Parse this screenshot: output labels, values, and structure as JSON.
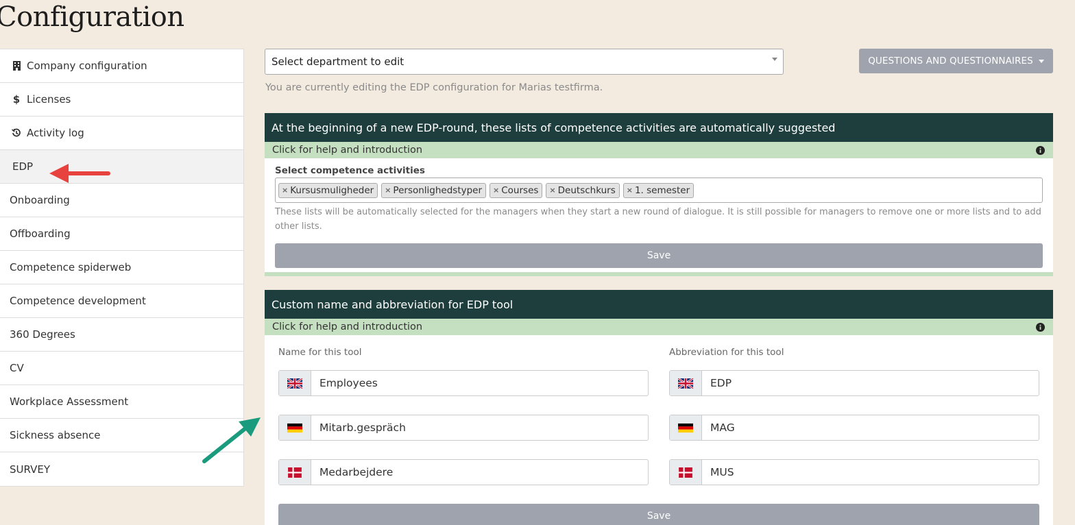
{
  "page": {
    "title": "Configuration"
  },
  "sidebar": {
    "items": [
      {
        "label": "Company configuration",
        "icon": "building-icon"
      },
      {
        "label": "Licenses",
        "icon": "dollar-icon"
      },
      {
        "label": "Activity log",
        "icon": "history-icon"
      },
      {
        "label": "EDP",
        "active": true
      },
      {
        "label": "Onboarding"
      },
      {
        "label": "Offboarding"
      },
      {
        "label": "Competence spiderweb"
      },
      {
        "label": "Competence development"
      },
      {
        "label": "360 Degrees"
      },
      {
        "label": "CV"
      },
      {
        "label": "Workplace Assessment"
      },
      {
        "label": "Sickness absence"
      },
      {
        "label": "SURVEY"
      }
    ]
  },
  "top": {
    "department_select": "Select department to edit",
    "questions_button": "QUESTIONS AND QUESTIONNAIRES",
    "edit_note": "You are currently editing the EDP configuration for Marias testfirma."
  },
  "panel1": {
    "header": "At the beginning of a new EDP-round, these lists of competence activities are automatically suggested",
    "help": "Click for help and introduction",
    "field_label": "Select competence activities",
    "tags": [
      "Kursusmuligheder",
      "Personlighedstyper",
      "Courses",
      "Deutschkurs",
      "1. semester"
    ],
    "tag_remove_symbol": "×",
    "help_text": "These lists will be automatically selected for the managers when they start a new round of dialogue. It is still possible for managers to remove one or more lists and to add other lists.",
    "save": "Save"
  },
  "panel2": {
    "header": "Custom name and abbreviation for EDP tool",
    "help": "Click for help and introduction",
    "name_label": "Name for this tool",
    "abbr_label": "Abbreviation for this tool",
    "names": [
      {
        "flag": "uk-flag-icon",
        "value": "Employees"
      },
      {
        "flag": "de-flag-icon",
        "value": "Mitarb.gespräch"
      },
      {
        "flag": "dk-flag-icon",
        "value": "Medarbejdere"
      }
    ],
    "abbreviations": [
      {
        "flag": "uk-flag-icon",
        "value": "EDP"
      },
      {
        "flag": "de-flag-icon",
        "value": "MAG"
      },
      {
        "flag": "dk-flag-icon",
        "value": "MUS"
      }
    ],
    "save": "Save"
  },
  "colors": {
    "background": "#f3ebe0",
    "panel_header": "#1e3e3e",
    "help_bar": "#c5e0c0",
    "button_gray": "#9ea3ad",
    "red_arrow": "#e8423f",
    "green_arrow": "#1a9b7d"
  }
}
